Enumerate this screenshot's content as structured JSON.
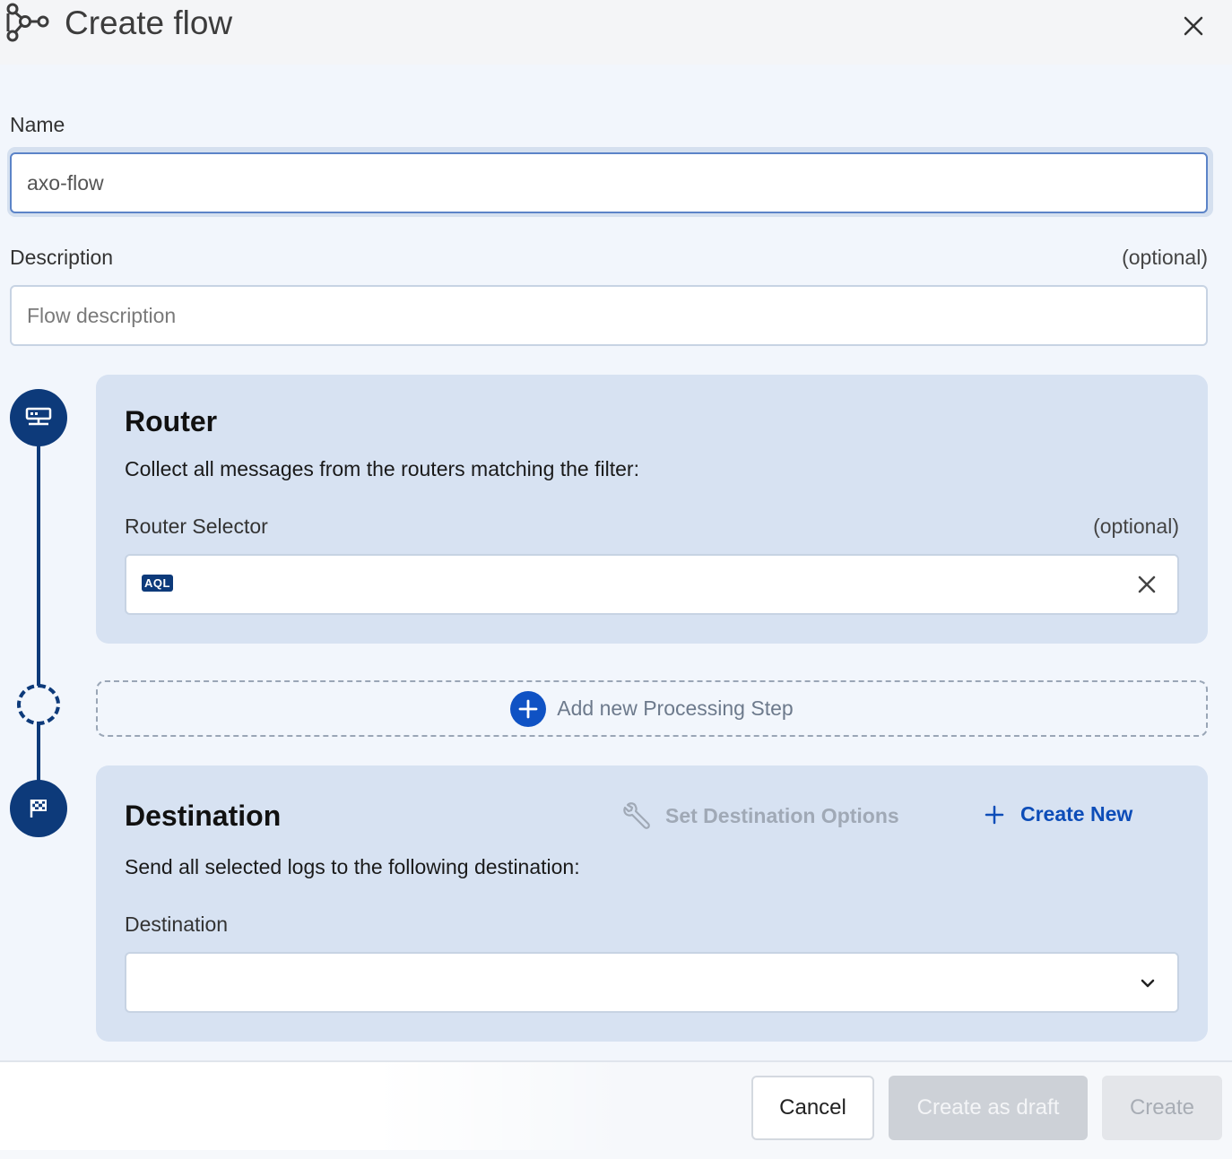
{
  "header": {
    "title": "Create flow",
    "flow_icon": "flow-nodes-icon",
    "close_icon": "close-icon"
  },
  "form": {
    "name_label": "Name",
    "name_value": "axo-flow",
    "description_label": "Description",
    "description_optional": "(optional)",
    "description_placeholder": "Flow description"
  },
  "router": {
    "icon": "router-icon",
    "title": "Router",
    "text": "Collect all messages from the routers matching the filter:",
    "selector_label": "Router Selector",
    "selector_optional": "(optional)",
    "badge": "AQL",
    "selector_value": "",
    "clear_icon": "close-icon"
  },
  "processing": {
    "add_label": "Add new Processing Step",
    "icon": "plus-icon"
  },
  "destination": {
    "icon": "flag-icon",
    "title": "Destination",
    "options_label": "Set Destination Options",
    "options_icon": "wrench-icon",
    "create_new_label": "Create New",
    "create_new_icon": "plus-icon",
    "text": "Send all selected logs to the following destination:",
    "field_label": "Destination",
    "selected_value": "",
    "dropdown_icon": "chevron-down-icon"
  },
  "footer": {
    "cancel_label": "Cancel",
    "draft_label": "Create as draft",
    "create_label": "Create"
  },
  "colors": {
    "accent": "#0f52c4",
    "timeline": "#0d3a7a",
    "card_bg": "#d7e2f2",
    "page_bg": "#f2f6fc"
  }
}
